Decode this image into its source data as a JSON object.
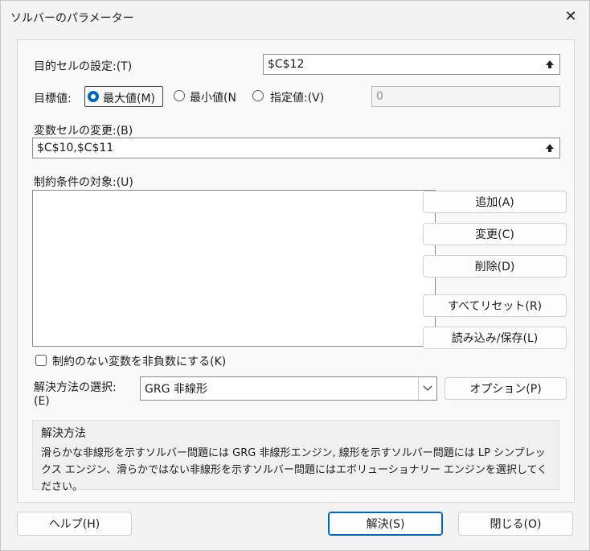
{
  "window": {
    "title": "ソルバーのパラメーター",
    "close_glyph": "✕"
  },
  "objective": {
    "label": "目的セルの設定:(T)",
    "value": "$C$12"
  },
  "target": {
    "label": "目標値:",
    "max_label": "最大値(M)",
    "min_label": "最小値(N",
    "value_of_label": "指定値:(V)",
    "value_input": "0",
    "selected": "max"
  },
  "changing": {
    "label": "変数セルの変更:(B)",
    "value": "$C$10,$C$11"
  },
  "constraints": {
    "label": "制約条件の対象:(U)",
    "items": [],
    "add_label": "追加(A)",
    "change_label": "変更(C)",
    "delete_label": "削除(D)",
    "reset_label": "すべてリセット(R)",
    "load_save_label": "読み込み/保存(L)"
  },
  "nonneg": {
    "label": "制約のない変数を非負数にする(K)",
    "checked": false
  },
  "method": {
    "label_line1": "解決方法の選択:",
    "label_line2": "(E)",
    "selected": "GRG 非線形",
    "options_label": "オプション(P)"
  },
  "description": {
    "title": "解決方法",
    "text": "滑らかな非線形を示すソルバー問題には GRG 非線形エンジン, 線形を示すソルバー問題には LP シンプレックス エンジン、滑らかではない非線形を示すソルバー問題にはエボリューショナリー エンジンを選択してください。"
  },
  "footer": {
    "help_label": "ヘルプ(H)",
    "solve_label": "解決(S)",
    "close_label": "閉じる(O)"
  },
  "colors": {
    "accent": "#0067c0",
    "background": "#f3f3f3"
  }
}
